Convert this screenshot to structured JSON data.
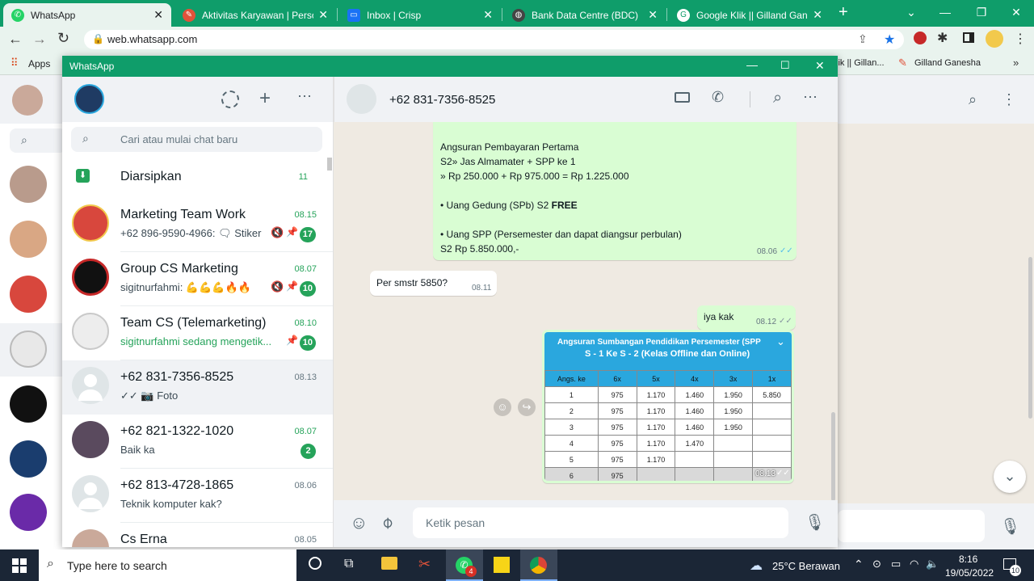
{
  "browser": {
    "tabs": [
      {
        "title": "WhatsApp",
        "active": true
      },
      {
        "title": "Aktivitas Karyawan | Personal"
      },
      {
        "title": "Inbox | Crisp"
      },
      {
        "title": "Bank Data Centre (BDC)"
      },
      {
        "title": "Google Klik || Gilland Ganesh"
      }
    ],
    "new_tab": "+",
    "url": "web.whatsapp.com",
    "bookmarks": {
      "apps": "Apps",
      "item1": "lik || Gillan...",
      "item2": "Gilland Ganesha",
      "more": "»"
    }
  },
  "popup": {
    "title": "WhatsApp"
  },
  "sidebar": {
    "search_placeholder": "Cari atau mulai chat baru",
    "archived": {
      "label": "Diarsipkan",
      "count": "11"
    },
    "chats": [
      {
        "name": "Marketing Team Work",
        "time": "08.15",
        "preview": "+62 896-9590-4966: 🗨 Stiker",
        "badge": "17",
        "muted": true,
        "pinned": true
      },
      {
        "name": "Group CS Marketing",
        "time": "08.07",
        "preview": "sigitnurfahmi: 💪💪💪🔥🔥",
        "badge": "10",
        "muted": true,
        "pinned": true
      },
      {
        "name": "Team CS (Telemarketing)",
        "time": "08.10",
        "preview": "sigitnurfahmi sedang mengetik...",
        "badge": "10",
        "pinned": true
      },
      {
        "name": "+62 831-7356-8525",
        "time": "08.13",
        "preview": "✓✓ 📷 Foto"
      },
      {
        "name": "+62 821-1322-1020",
        "time": "08.07",
        "preview": "Baik ka",
        "badge": "2"
      },
      {
        "name": "+62 813-4728-1865",
        "time": "08.06",
        "preview": "Teknik komputer kak?"
      },
      {
        "name": "Cs Erna",
        "time": "08.05",
        "preview": ""
      }
    ]
  },
  "chat": {
    "contact": "+62 831-7356-8525",
    "messages": {
      "m1_lines": [
        "Angsuran Pembayaran Pertama",
        "S2» Jas Almamater + SPP ke 1",
        "» Rp 250.000 + Rp 975.000 = Rp 1.225.000",
        "",
        "• Uang Gedung (SPb) S2 ",
        "",
        "• Uang SPP (Persemester dan dapat diangsur perbulan)",
        "S2 Rp 5.850.000,-"
      ],
      "m1_free": "FREE",
      "m1_time": "08.06",
      "m2_text": "Per smstr 5850?",
      "m2_time": "08.11",
      "m3_text": "iya kak",
      "m3_time": "08.12",
      "m4_time": "08.13"
    },
    "input_placeholder": "Ketik pesan"
  },
  "spp_table": {
    "title_line1": "Angsuran Sumbangan Pendidikan Persemester (SPP",
    "title_line2": "S - 1 Ke S - 2 (Kelas Offline dan Online)",
    "headers": [
      "Angs. ke",
      "6x",
      "5x",
      "4x",
      "3x",
      "1x"
    ],
    "rows": [
      [
        "1",
        "975",
        "1.170",
        "1.460",
        "1.950",
        "5.850"
      ],
      [
        "2",
        "975",
        "1.170",
        "1.460",
        "1.950",
        ""
      ],
      [
        "3",
        "975",
        "1.170",
        "1.460",
        "1.950",
        ""
      ],
      [
        "4",
        "975",
        "1.170",
        "1.470",
        "",
        ""
      ],
      [
        "5",
        "975",
        "1.170",
        "",
        "",
        ""
      ],
      [
        "6",
        "975",
        "",
        "",
        "",
        ""
      ]
    ]
  },
  "taskbar": {
    "search": "Type here to search",
    "whatsapp_badge": "4",
    "weather": "25°C  Berawan",
    "time": "8:16",
    "date": "19/05/2022",
    "notif": "10"
  },
  "colors": {
    "brand": "#0f9d6a",
    "bubble_out": "#d9fdd3",
    "badge": "#25a35a"
  }
}
